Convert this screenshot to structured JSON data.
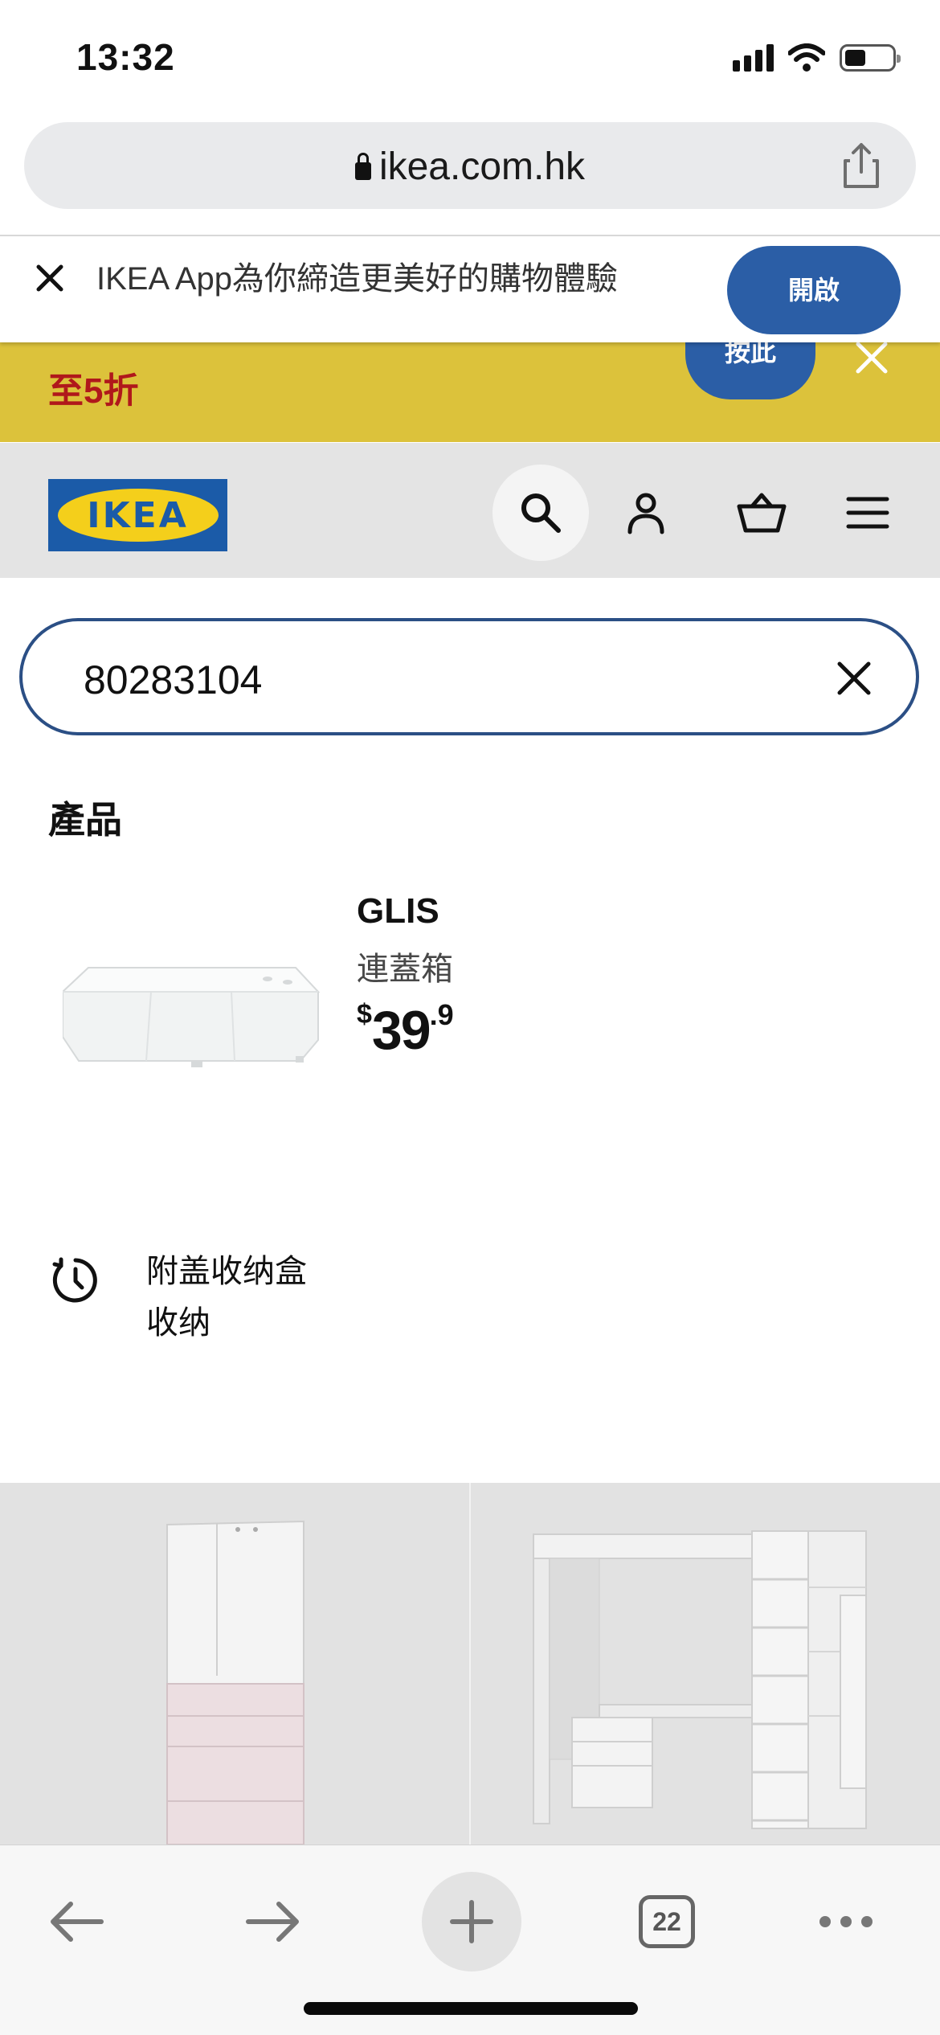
{
  "status_bar": {
    "time": "13:32"
  },
  "browser": {
    "url": "ikea.com.hk"
  },
  "app_banner": {
    "text": "IKEA App為你締造更美好的購物體驗",
    "open_label": "開啟"
  },
  "promo": {
    "text": "至5折",
    "button_label": "按此"
  },
  "header": {
    "logo_text": "IKEA"
  },
  "search": {
    "value": "80283104"
  },
  "results": {
    "section_title": "產品",
    "product": {
      "name": "GLIS",
      "type": "連蓋箱",
      "price_currency": "$",
      "price_int": "39",
      "price_dec": ".9"
    },
    "history": {
      "line1": "附盖收纳盒",
      "line2": "收纳"
    }
  },
  "toolbar": {
    "tab_count": "22"
  },
  "colors": {
    "ikea_blue": "#2b5ea6",
    "promo_yellow": "#dcc23b",
    "promo_red": "#b0181b",
    "search_border": "#2b4f85"
  }
}
